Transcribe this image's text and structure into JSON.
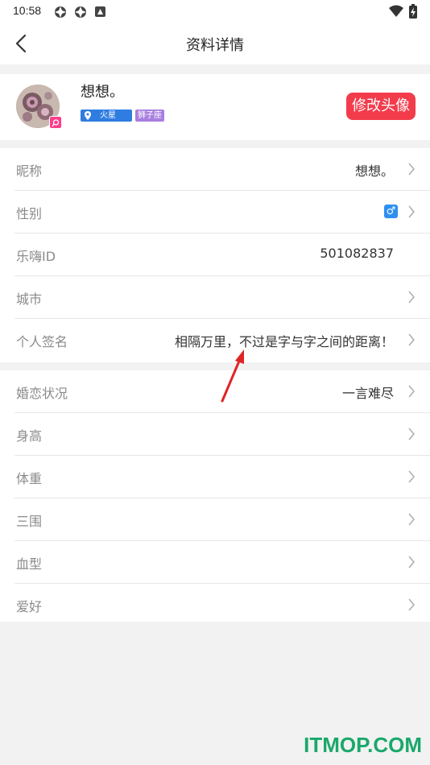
{
  "status_bar": {
    "time": "10:58",
    "icons": [
      "app-icon-1",
      "app-icon-2",
      "notification-icon",
      "wifi-icon",
      "battery-charging-icon"
    ]
  },
  "header": {
    "title": "资料详情",
    "back_icon": "back-arrow-icon"
  },
  "profile": {
    "name": "想想。",
    "location_tag": "火星",
    "zodiac_tag": "狮子座",
    "change_avatar_label": "修改头像"
  },
  "basic_info": [
    {
      "label": "昵称",
      "value": "想想。"
    },
    {
      "label": "性别",
      "value": "♂"
    },
    {
      "label": "乐嗨ID",
      "value": "501082837"
    },
    {
      "label": "城市",
      "value": ""
    },
    {
      "label": "个人签名",
      "value": "相隔万里，不过是字与字之间的距离！"
    }
  ],
  "details": [
    {
      "label": "婚恋状况",
      "value": "一言难尽"
    },
    {
      "label": "身高",
      "value": ""
    },
    {
      "label": "体重",
      "value": ""
    },
    {
      "label": "三围",
      "value": ""
    },
    {
      "label": "血型",
      "value": ""
    },
    {
      "label": "爱好",
      "value": ""
    }
  ],
  "watermark": "ITMOP.COM",
  "colors": {
    "accent_red": "#f23c4c",
    "location_tag": "#2f7de1",
    "zodiac_tag": "#a87fe0",
    "gender_blue": "#2f8ff0",
    "watermark_green": "#1aa86b"
  }
}
